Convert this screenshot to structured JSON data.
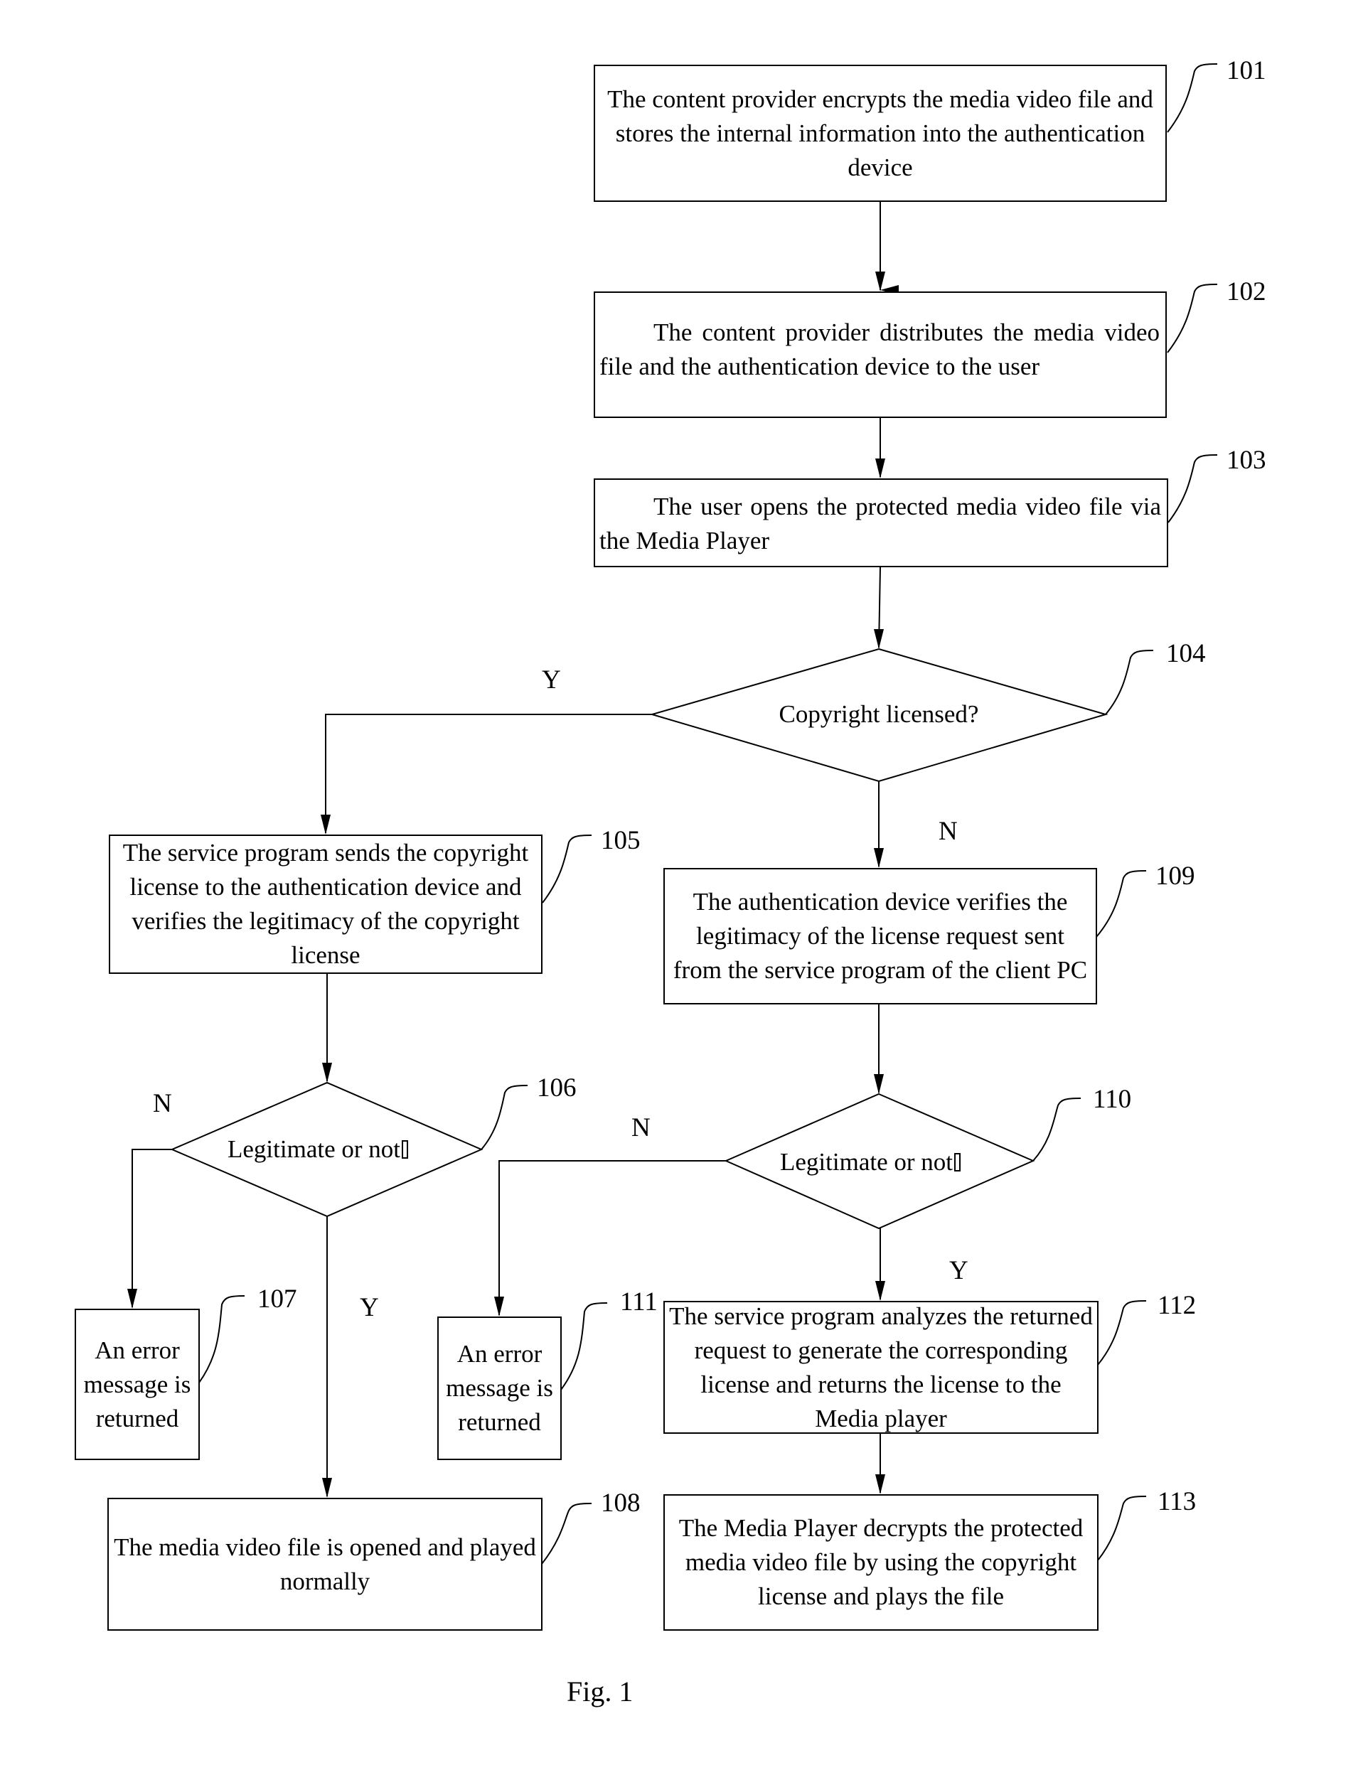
{
  "figure": {
    "caption": "Fig. 1",
    "steps": {
      "s101": {
        "ref": "101",
        "text": "The content provider encrypts the media video file and stores the internal information into the authentication device"
      },
      "s102": {
        "ref": "102",
        "text": "The content provider distributes the media video file  and the authentication device  to the user"
      },
      "s103": {
        "ref": "103",
        "text": "The user opens the protected media video file via the Media Player"
      },
      "s104": {
        "ref": "104",
        "text": "Copyright licensed?"
      },
      "s105": {
        "ref": "105",
        "text": "The service program sends the copyright license to the authentication device and verifies the legitimacy of the copyright license"
      },
      "s106": {
        "ref": "106",
        "text": "Legitimate or not"
      },
      "s107": {
        "ref": "107",
        "text": "An error message is returned"
      },
      "s108": {
        "ref": "108",
        "text": "The media video file is opened and played normally"
      },
      "s109": {
        "ref": "109",
        "text": "The authentication device verifies the legitimacy of the license request sent from the service program of the client PC"
      },
      "s110": {
        "ref": "110",
        "text": "Legitimate or not"
      },
      "s111": {
        "ref": "111",
        "text": "An error message is returned"
      },
      "s112": {
        "ref": "112",
        "text": "The service program analyzes the returned request to generate the corresponding license and returns the license to the Media player"
      },
      "s113": {
        "ref": "113",
        "text": "The Media Player decrypts the protected media video file by using the copyright license and  plays the file"
      }
    },
    "branch_labels": {
      "d104_yes": "Y",
      "d104_no": "N",
      "d106_no": "N",
      "d106_yes": "Y",
      "d110_no": "N",
      "d110_yes": "Y"
    }
  }
}
